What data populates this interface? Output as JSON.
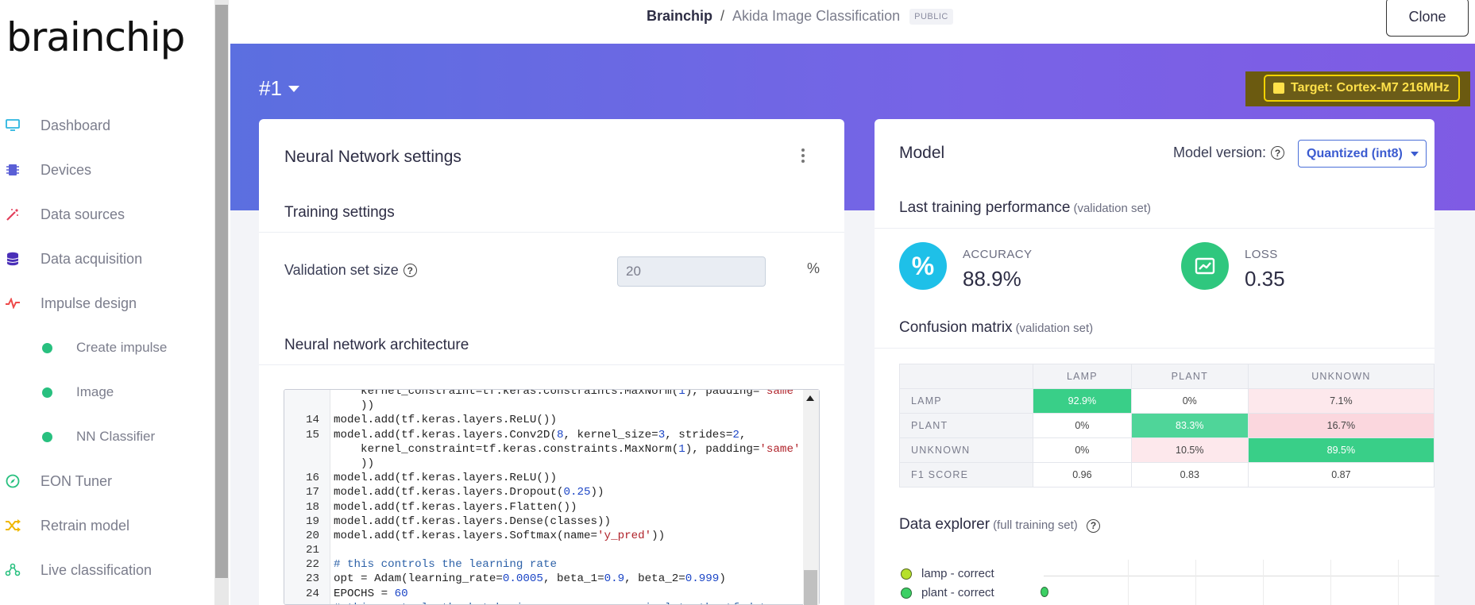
{
  "sidebar": {
    "logo": "brainchip",
    "items": [
      {
        "label": "Dashboard",
        "icon": "monitor-icon",
        "color": "#2bb6e0"
      },
      {
        "label": "Devices",
        "icon": "chip-icon",
        "color": "#5a5fd6"
      },
      {
        "label": "Data sources",
        "icon": "wand-icon",
        "color": "#e23f5a"
      },
      {
        "label": "Data acquisition",
        "icon": "database-icon",
        "color": "#4a2fb8"
      },
      {
        "label": "Impulse design",
        "icon": "pulse-icon",
        "color": "#ee4b4b"
      },
      {
        "label": "Create impulse",
        "icon": "dot-icon",
        "color": "#28c07f"
      },
      {
        "label": "Image",
        "icon": "dot-icon",
        "color": "#28c07f"
      },
      {
        "label": "NN Classifier",
        "icon": "dot-icon",
        "color": "#28c07f"
      },
      {
        "label": "EON Tuner",
        "icon": "compass-icon",
        "color": "#28c07f"
      },
      {
        "label": "Retrain model",
        "icon": "shuffle-icon",
        "color": "#f0b800"
      },
      {
        "label": "Live classification",
        "icon": "network-icon",
        "color": "#28c07f"
      }
    ]
  },
  "header": {
    "org": "Brainchip",
    "separator": "/",
    "project": "Akida Image Classification",
    "visibility": "PUBLIC",
    "clone_label": "Clone"
  },
  "hero": {
    "version": "#1",
    "target": "Target: Cortex-M7 216MHz"
  },
  "nn_settings": {
    "title": "Neural Network settings",
    "training_settings": "Training settings",
    "validation_label": "Validation set size",
    "validation_value": "20",
    "percent": "%",
    "architecture_title": "Neural network architecture",
    "code": [
      {
        "n": "",
        "parts": [
          [
            "t",
            "    kernel_constraint=tf.keras.constraints.MaxNorm("
          ],
          [
            "num",
            "1"
          ],
          [
            "t",
            "), padding="
          ],
          [
            "str",
            "'same'"
          ]
        ]
      },
      {
        "n": "",
        "parts": [
          [
            "t",
            "    ))"
          ]
        ]
      },
      {
        "n": "14",
        "parts": [
          [
            "t",
            "model.add(tf.keras.layers.ReLU())"
          ]
        ]
      },
      {
        "n": "15",
        "parts": [
          [
            "t",
            "model.add(tf.keras.layers.Conv2D("
          ],
          [
            "num",
            "8"
          ],
          [
            "t",
            ", kernel_size="
          ],
          [
            "num",
            "3"
          ],
          [
            "t",
            ", strides="
          ],
          [
            "num",
            "2"
          ],
          [
            "t",
            ","
          ]
        ]
      },
      {
        "n": "",
        "parts": [
          [
            "t",
            "    kernel_constraint=tf.keras.constraints.MaxNorm("
          ],
          [
            "num",
            "1"
          ],
          [
            "t",
            "), padding="
          ],
          [
            "str",
            "'same'"
          ]
        ]
      },
      {
        "n": "",
        "parts": [
          [
            "t",
            "    ))"
          ]
        ]
      },
      {
        "n": "16",
        "parts": [
          [
            "t",
            "model.add(tf.keras.layers.ReLU())"
          ]
        ]
      },
      {
        "n": "17",
        "parts": [
          [
            "t",
            "model.add(tf.keras.layers.Dropout("
          ],
          [
            "num",
            "0.25"
          ],
          [
            "t",
            "))"
          ]
        ]
      },
      {
        "n": "18",
        "parts": [
          [
            "t",
            "model.add(tf.keras.layers.Flatten())"
          ]
        ]
      },
      {
        "n": "19",
        "parts": [
          [
            "t",
            "model.add(tf.keras.layers.Dense(classes))"
          ]
        ]
      },
      {
        "n": "20",
        "parts": [
          [
            "t",
            "model.add(tf.keras.layers.Softmax(name="
          ],
          [
            "str",
            "'y_pred'"
          ],
          [
            "t",
            "))"
          ]
        ]
      },
      {
        "n": "21",
        "parts": [
          [
            "t",
            ""
          ]
        ]
      },
      {
        "n": "22",
        "parts": [
          [
            "cmt",
            "# this controls the learning rate"
          ]
        ]
      },
      {
        "n": "23",
        "parts": [
          [
            "t",
            "opt = Adam(learning_rate="
          ],
          [
            "num",
            "0.0005"
          ],
          [
            "t",
            ", beta_1="
          ],
          [
            "num",
            "0.9"
          ],
          [
            "t",
            ", beta_2="
          ],
          [
            "num",
            "0.999"
          ],
          [
            "t",
            ")"
          ]
        ]
      },
      {
        "n": "24",
        "parts": [
          [
            "t",
            "EPOCHS = "
          ],
          [
            "num",
            "60"
          ]
        ]
      },
      {
        "n": "",
        "parts": [
          [
            "cmt",
            "# this controls the batch size, or you can manipulate the tf.data"
          ]
        ]
      }
    ]
  },
  "model": {
    "title": "Model",
    "version_label": "Model version:",
    "version_value": "Quantized (int8)",
    "perf_title": "Last training performance",
    "perf_note": "(validation set)",
    "accuracy_label": "ACCURACY",
    "accuracy_value": "88.9%",
    "accuracy_symbol": "%",
    "loss_label": "LOSS",
    "loss_value": "0.35",
    "accuracy_color": "#1ec0e8",
    "loss_color": "#2fc77e",
    "cm_title": "Confusion matrix",
    "cm_note": "(validation set)",
    "cm_headers": [
      "LAMP",
      "PLANT",
      "UNKNOWN"
    ],
    "cm_rows": [
      {
        "label": "LAMP",
        "cells": [
          "92.9%",
          "0%",
          "7.1%"
        ]
      },
      {
        "label": "PLANT",
        "cells": [
          "0%",
          "83.3%",
          "16.7%"
        ]
      },
      {
        "label": "UNKNOWN",
        "cells": [
          "0%",
          "10.5%",
          "89.5%"
        ]
      },
      {
        "label": "F1 SCORE",
        "cells": [
          "0.96",
          "0.83",
          "0.87"
        ]
      }
    ],
    "explorer_title": "Data explorer",
    "explorer_note": "(full training set)",
    "legend": [
      "lamp - correct",
      "plant - correct"
    ]
  }
}
